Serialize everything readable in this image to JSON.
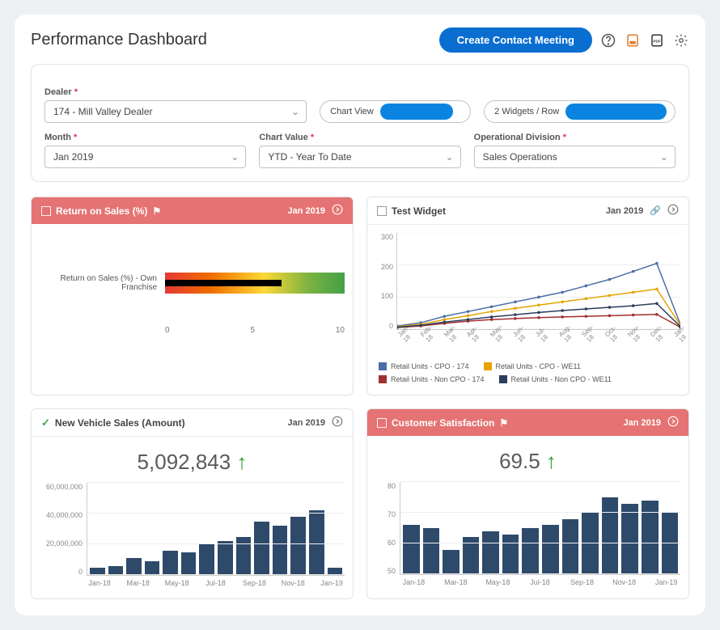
{
  "page_title": "Performance Dashboard",
  "header": {
    "primary_button": "Create Contact Meeting"
  },
  "filters": {
    "dealer": {
      "label": "Dealer",
      "value": "174 - Mill Valley Dealer"
    },
    "chart_view": {
      "label": "Chart View"
    },
    "widgets_per_row": {
      "label": "2 Widgets / Row"
    },
    "month": {
      "label": "Month",
      "value": "Jan 2019"
    },
    "chart_value": {
      "label": "Chart Value",
      "value": "YTD - Year To Date"
    },
    "operational_division": {
      "label": "Operational Division",
      "value": "Sales Operations"
    }
  },
  "widgets": {
    "return_on_sales": {
      "title": "Return on Sales (%)",
      "period": "Jan 2019",
      "bullet_label": "Return on Sales (%) - Own Franchise"
    },
    "test_widget": {
      "title": "Test Widget",
      "period": "Jan 2019",
      "legend": {
        "s1": "Retail Units - CPO - 174",
        "s2": "Retail Units - CPO - WE11",
        "s3": "Retail Units - Non CPO - 174",
        "s4": "Retail Units - Non CPO - WE11"
      }
    },
    "new_vehicle": {
      "title": "New Vehicle Sales (Amount)",
      "period": "Jan 2019",
      "metric": "5,092,843"
    },
    "customer_satisfaction": {
      "title": "Customer Satisfaction",
      "period": "Jan 2019",
      "metric": "69.5"
    }
  },
  "chart_data": [
    {
      "id": "return_on_sales_bullet",
      "type": "bar",
      "title": "Return on Sales (%)",
      "categories": [
        "Return on Sales (%) - Own Franchise"
      ],
      "values": [
        6.5
      ],
      "xlabel": "",
      "ylabel": "",
      "ylim": [
        0,
        10
      ],
      "ticks": [
        0,
        5,
        10
      ]
    },
    {
      "id": "test_widget_line",
      "type": "line",
      "title": "Test Widget",
      "x": [
        "Jan-18",
        "Feb-18",
        "Mar-18",
        "Apr-18",
        "May-18",
        "Jun-18",
        "Jul-18",
        "Aug-18",
        "Sep-18",
        "Oct-18",
        "Nov-18",
        "Dec-18",
        "Jan-19"
      ],
      "series": [
        {
          "name": "Retail Units - CPO - 174",
          "color": "#4a6fa5",
          "values": [
            10,
            20,
            40,
            55,
            70,
            85,
            100,
            115,
            135,
            155,
            180,
            205,
            15
          ]
        },
        {
          "name": "Retail Units - CPO - WE11",
          "color": "#e6a400",
          "values": [
            8,
            15,
            30,
            42,
            55,
            65,
            75,
            85,
            95,
            105,
            115,
            125,
            12
          ]
        },
        {
          "name": "Retail Units - Non CPO - 174",
          "color": "#a03030",
          "values": [
            5,
            10,
            18,
            25,
            30,
            33,
            36,
            38,
            40,
            42,
            44,
            46,
            6
          ]
        },
        {
          "name": "Retail Units - Non CPO - WE11",
          "color": "#2b3d5b",
          "values": [
            6,
            12,
            22,
            30,
            38,
            45,
            52,
            58,
            63,
            68,
            73,
            80,
            8
          ]
        }
      ],
      "ylim": [
        0,
        300
      ],
      "yticks": [
        0,
        100,
        200,
        300
      ],
      "legend_position": "bottom"
    },
    {
      "id": "new_vehicle_bar",
      "type": "bar",
      "title": "New Vehicle Sales (Amount)",
      "categories": [
        "Jan-18",
        "Feb-18",
        "Mar-18",
        "Apr-18",
        "May-18",
        "Jun-18",
        "Jul-18",
        "Aug-18",
        "Sep-18",
        "Oct-18",
        "Nov-18",
        "Dec-18",
        "Jan-19"
      ],
      "values": [
        5000000,
        6000000,
        11000000,
        9000000,
        16000000,
        15000000,
        20000000,
        22000000,
        25000000,
        35000000,
        32000000,
        38000000,
        42000000,
        5000000
      ],
      "x_visible_labels": [
        "Jan-18",
        "Mar-18",
        "May-18",
        "Jul-18",
        "Sep-18",
        "Nov-18",
        "Jan-19"
      ],
      "ylim": [
        0,
        60000000
      ],
      "yticks": [
        0,
        20000000,
        40000000,
        60000000
      ]
    },
    {
      "id": "customer_satisfaction_bar",
      "type": "bar",
      "title": "Customer Satisfaction",
      "categories": [
        "Jan-18",
        "Feb-18",
        "Mar-18",
        "Apr-18",
        "May-18",
        "Jun-18",
        "Jul-18",
        "Aug-18",
        "Sep-18",
        "Oct-18",
        "Nov-18",
        "Dec-18",
        "Jan-19"
      ],
      "values": [
        66,
        65,
        58,
        62,
        64,
        63,
        65,
        66,
        68,
        70,
        75,
        73,
        74,
        70
      ],
      "x_visible_labels": [
        "Jan-18",
        "Mar-18",
        "May-18",
        "Jul-18",
        "Sep-18",
        "Nov-18",
        "Jan-19"
      ],
      "ylim": [
        50,
        80
      ],
      "yticks": [
        50,
        60,
        70,
        80
      ]
    }
  ]
}
